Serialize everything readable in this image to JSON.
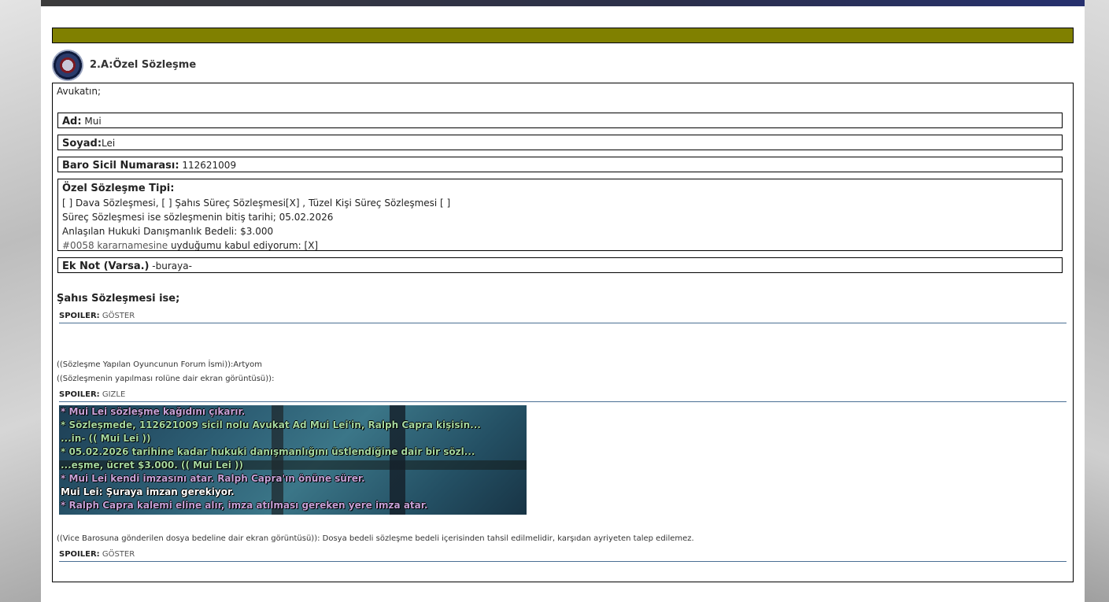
{
  "post": {
    "title": "2.A:Özel Sözleşme",
    "intro": "Avukatın;",
    "fields": {
      "ad_label": "Ad:",
      "ad_value": " Mui",
      "soyad_label": "Soyad:",
      "soyad_value": "Lei",
      "baro_label": "Baro Sicil Numarası:",
      "baro_value": " 112621009",
      "tip_label": "Özel Sözleşme Tipi:",
      "tip_line1": "[ ] Dava Sözleşmesi, [ ] Şahıs Süreç Sözleşmesi[X] , Tüzel Kişi Süreç Sözleşmesi [ ]",
      "tip_line2": "Süreç Sözleşmesi ise sözleşmenin bitiş tarihi; 05.02.2026",
      "tip_line3": "Anlaşılan Hukuki Danışmanlık Bedeli: $3.000",
      "tip_line4_link": "#0058 kararnamesine",
      "tip_line4_rest": " uyduğumu kabul ediyorum: [X]",
      "eknot_label": "Ek Not (Varsa.)",
      "eknot_value": " -buraya-"
    },
    "section_title": "Şahıs Sözleşmesi ise;",
    "spoiler_key": "SPOILER:",
    "spoiler1_action": "GÖSTER",
    "ooc_forum": "((Sözleşme Yapılan Oyuncunun Forum İsmi)):Artyom",
    "ooc_screenshot": "((Sözleşmenin yapılması rolüne dair ekran görüntüsü)):",
    "spoiler2_action": "GIZLE",
    "chat_lines": [
      "* Mui Lei sözleşme kağıdını çıkarır.",
      "* Sözleşmede, 112621009 sicil nolu Avukat Ad Mui Lei'in, Ralph Capra kişisin...",
      "...in- (( Mui Lei ))",
      "* 05.02.2026 tarihine kadar hukuki danışmanlığını üstlendiğine dair bir sözl...",
      "...eşme, ücret $3.000. (( Mui Lei ))",
      "* Mui Lei kendi imzasını atar. Ralph Capra'ın önüne sürer.",
      "Mui Lei: Şuraya imzan gerekiyor.",
      "* Ralph Capra kalemi eline alır, imza atılması gereken yere imza atar."
    ],
    "ooc_fee": "((Vice Barosuna gönderilen dosya bedeline dair ekran görüntüsü)): Dosya bedeli sözleşme bedeli içerisinden tahsil edilmelidir, karşıdan ayriyeten talep edilemez.",
    "spoiler3_action": "GÖSTER"
  }
}
